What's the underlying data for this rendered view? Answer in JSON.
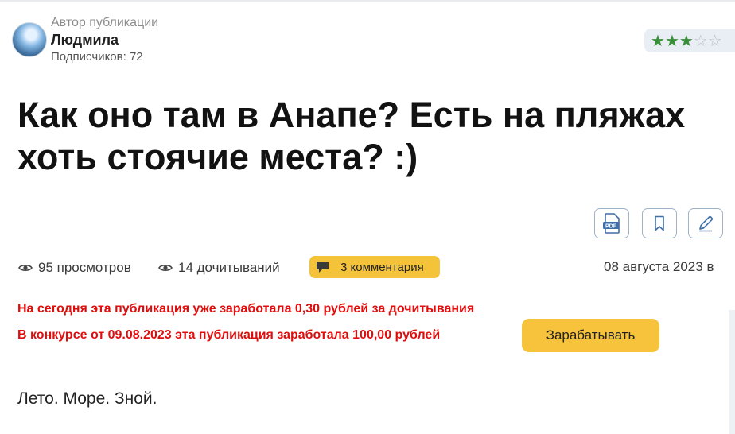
{
  "author": {
    "caption": "Автор публикации",
    "name": "Людмила",
    "subscribers": "Подписчиков: 72"
  },
  "rating": {
    "stars_filled": 3,
    "stars_total": 5
  },
  "article": {
    "title": "Как оно там в Анапе? Есть на пляжах хоть стоячие места? :)",
    "body_start": "Лето. Море. Зной."
  },
  "toolbar": {
    "pdf_label": "PDF"
  },
  "stats": {
    "views": "95 просмотров",
    "reads": "14 дочитываний",
    "comments": "3 комментария",
    "date": "08 августа 2023 в"
  },
  "earnings": {
    "today": "На сегодня эта публикация уже заработала 0,30 рублей за дочитывания",
    "contest": "В конкурсе от 09.08.2023 эта публикация заработала 100,00 рублей",
    "button": "Зарабатывать"
  },
  "colors": {
    "accent_yellow": "#f7c23c",
    "earnings_red": "#e00d0d",
    "star_green": "#3a8f3a",
    "icon_blue": "#3f6fa6"
  }
}
